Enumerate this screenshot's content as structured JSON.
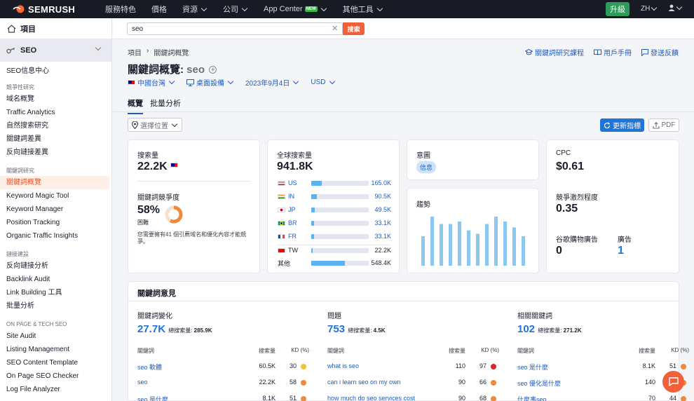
{
  "topbar": {
    "brand": "SEMRUSH",
    "nav": [
      "服務特色",
      "價格",
      "資源",
      "公司",
      "App Center",
      "其他工具"
    ],
    "new_badge": "NEW",
    "upgrade": "升級",
    "lang": "ZH"
  },
  "sidebar": {
    "projects": "項目",
    "seo": "SEO",
    "overview": "SEO信息中心",
    "sections": [
      {
        "title": "競爭性研究",
        "items": [
          "域名概覽",
          "Traffic Analytics",
          "自然搜索研究",
          "關鍵詞差異",
          "反向鏈接差異"
        ]
      },
      {
        "title": "關鍵詞研究",
        "items": [
          "關鍵詞概覽",
          "Keyword Magic Tool",
          "Keyword Manager",
          "Position Tracking",
          "Organic Traffic Insights"
        ]
      },
      {
        "title": "鏈接建設",
        "items": [
          "反向鏈接分析",
          "Backlink Audit",
          "Link Building 工具",
          "批量分析"
        ]
      },
      {
        "title": "ON PAGE & TECH SEO",
        "items": [
          "Site Audit",
          "Listing Management",
          "SEO Content Template",
          "On Page SEO Checker",
          "Log File Analyzer"
        ]
      }
    ]
  },
  "search": {
    "value": "seo",
    "button": "搜索"
  },
  "breadcrumb": [
    "項目",
    "關鍵詞概覽"
  ],
  "toplinks": [
    "關鍵詞研究課程",
    "用戶手冊",
    "發送反饋"
  ],
  "title": {
    "label": "關鍵詞概覽:",
    "keyword": "seo"
  },
  "filters": [
    "中國台灣",
    "桌面設備",
    "2023年9月4日",
    "USD"
  ],
  "tabs": [
    "概覽",
    "批量分析"
  ],
  "location_select": "選擇位置",
  "update_btn": "更新指標",
  "pdf_btn": "PDF",
  "volume": {
    "label": "搜索量",
    "value": "22.2K",
    "kd_label": "關鍵詞競爭度",
    "kd_value": "58%",
    "kd_text": "困難",
    "kd_percent": 58,
    "kd_note": "您需要擁有41 個引薦域名和優化內容才能競爭。"
  },
  "global": {
    "label": "全球搜索量",
    "value": "941.8K",
    "rows": [
      {
        "cc": "US",
        "val": "165.0K",
        "fill": 0.18
      },
      {
        "cc": "IN",
        "val": "90.5K",
        "fill": 0.1
      },
      {
        "cc": "JP",
        "val": "49.5K",
        "fill": 0.06
      },
      {
        "cc": "BR",
        "val": "33.1K",
        "fill": 0.045
      },
      {
        "cc": "FR",
        "val": "33.1K",
        "fill": 0.045
      }
    ],
    "tw": {
      "cc": "TW",
      "val": "22.2K",
      "fill": 0.025
    },
    "other": {
      "cc": "其他",
      "val": "548.4K",
      "fill": 0.58
    }
  },
  "intent": {
    "label": "意圖",
    "value": "信息"
  },
  "trend": {
    "label": "趨勢",
    "values": [
      0.6,
      1.0,
      0.85,
      0.85,
      0.9,
      0.72,
      0.65,
      0.85,
      1.0,
      0.9,
      0.78,
      0.6
    ]
  },
  "cpc": {
    "label": "CPC",
    "value": "$0.61",
    "comp_label": "競爭激烈程度",
    "comp_value": "0.35",
    "shop_label": "谷歌購物廣告",
    "shop_value": "0",
    "ads_label": "廣告",
    "ads_value": "1"
  },
  "ideas": {
    "title": "關鍵詞意見",
    "cols": [
      {
        "title": "關鍵詞變化",
        "count": "27.7K",
        "total_label": "總搜索量:",
        "total": "285.9K",
        "rows": [
          [
            "seo 軟體",
            "60.5K",
            "30",
            "#f5c23c"
          ],
          [
            "seo",
            "22.2K",
            "58",
            "#ef8a3d"
          ],
          [
            "seo 是什麼",
            "8.1K",
            "51",
            "#ef8a3d"
          ]
        ]
      },
      {
        "title": "問題",
        "count": "753",
        "total_label": "總搜索量:",
        "total": "4.5K",
        "rows": [
          [
            "what is seo",
            "110",
            "97",
            "#d42a2a"
          ],
          [
            "can i learn seo on my own",
            "90",
            "66",
            "#ef8a3d"
          ],
          [
            "how much do seo services cost",
            "90",
            "68",
            "#ef8a3d"
          ]
        ]
      },
      {
        "title": "相關關鍵詞",
        "count": "102",
        "total_label": "總搜索量:",
        "total": "271.2K",
        "rows": [
          [
            "seo 是什麼",
            "8.1K",
            "51",
            "#ef8a3d"
          ],
          [
            "seo 優化是什麼",
            "140",
            "43",
            "#ef8a3d"
          ],
          [
            "什麼事seo",
            "70",
            "44",
            "#ef8a3d"
          ]
        ]
      }
    ],
    "th": [
      "關鍵詞",
      "搜索量",
      "KD (%)"
    ]
  }
}
